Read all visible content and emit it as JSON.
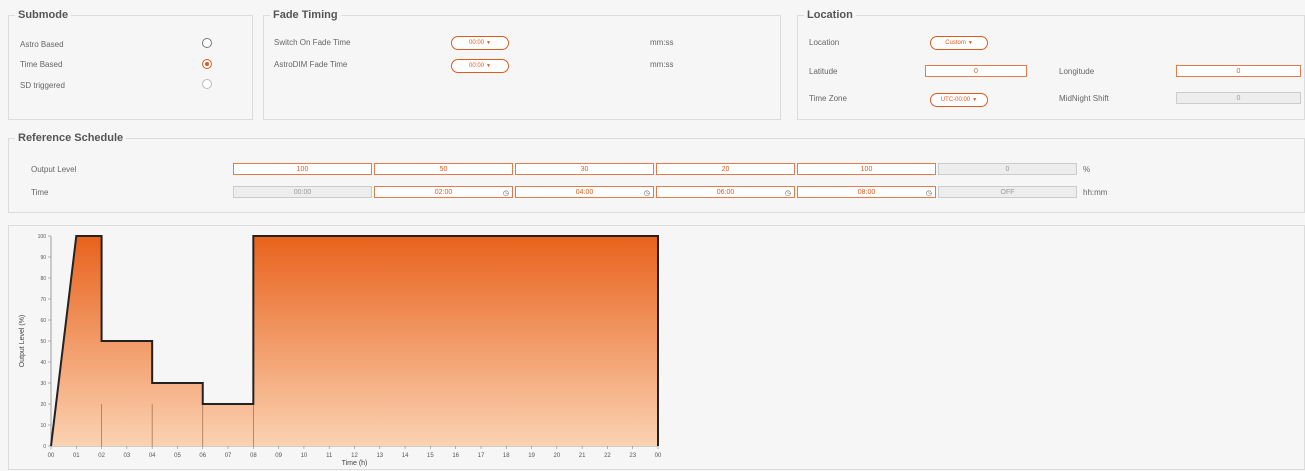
{
  "submode": {
    "title": "Submode",
    "options": [
      {
        "label": "Astro Based",
        "selected": false
      },
      {
        "label": "Time Based",
        "selected": true
      },
      {
        "label": "SD triggered",
        "selected": false
      }
    ]
  },
  "fade": {
    "title": "Fade Timing",
    "switch_on_label": "Switch On Fade Time",
    "switch_on_value": "00:00",
    "switch_on_unit": "mm:ss",
    "astrodim_label": "AstroDIM Fade Time",
    "astrodim_value": "00:00",
    "astrodim_unit": "mm:ss"
  },
  "location": {
    "title": "Location",
    "location_label": "Location",
    "location_value": "Custom",
    "latitude_label": "Latitude",
    "latitude_value": "0",
    "longitude_label": "Longitude",
    "longitude_value": "0",
    "timezone_label": "Time Zone",
    "timezone_value": "UTC-00:00",
    "midnight_label": "MidNight Shift",
    "midnight_value": "0"
  },
  "schedule": {
    "title": "Reference Schedule",
    "output_label": "Output Level",
    "output_values": [
      "100",
      "50",
      "30",
      "20",
      "100",
      "0"
    ],
    "output_unit": "%",
    "time_label": "Time",
    "time_values": [
      "00:00",
      "02:00",
      "04:00",
      "06:00",
      "08:00",
      "OFF"
    ],
    "time_unit": "hh:mm"
  },
  "chart_data": {
    "type": "area",
    "xlabel": "Time (h)",
    "ylabel": "Output Level (%)",
    "xlim": [
      0,
      24
    ],
    "ylim": [
      0,
      100
    ],
    "x_ticks": [
      "00",
      "01",
      "02",
      "03",
      "04",
      "05",
      "06",
      "07",
      "08",
      "09",
      "10",
      "11",
      "12",
      "13",
      "14",
      "15",
      "16",
      "17",
      "18",
      "19",
      "20",
      "21",
      "22",
      "23",
      "00"
    ],
    "y_ticks": [
      0,
      10,
      20,
      30,
      40,
      50,
      60,
      70,
      80,
      90,
      100
    ],
    "points": [
      {
        "x": 0,
        "y": 0
      },
      {
        "x": 1,
        "y": 100
      },
      {
        "x": 2,
        "y": 100
      },
      {
        "x": 2,
        "y": 50
      },
      {
        "x": 4,
        "y": 50
      },
      {
        "x": 4,
        "y": 30
      },
      {
        "x": 6,
        "y": 30
      },
      {
        "x": 6,
        "y": 20
      },
      {
        "x": 8,
        "y": 20
      },
      {
        "x": 8,
        "y": 100
      },
      {
        "x": 24,
        "y": 100
      },
      {
        "x": 24,
        "y": 0
      }
    ],
    "step_dividers_x": [
      2,
      4,
      6,
      8
    ],
    "fill_top_color": "#e8621c",
    "fill_bottom_color": "#fbd2b2",
    "line_color": "#222222"
  }
}
